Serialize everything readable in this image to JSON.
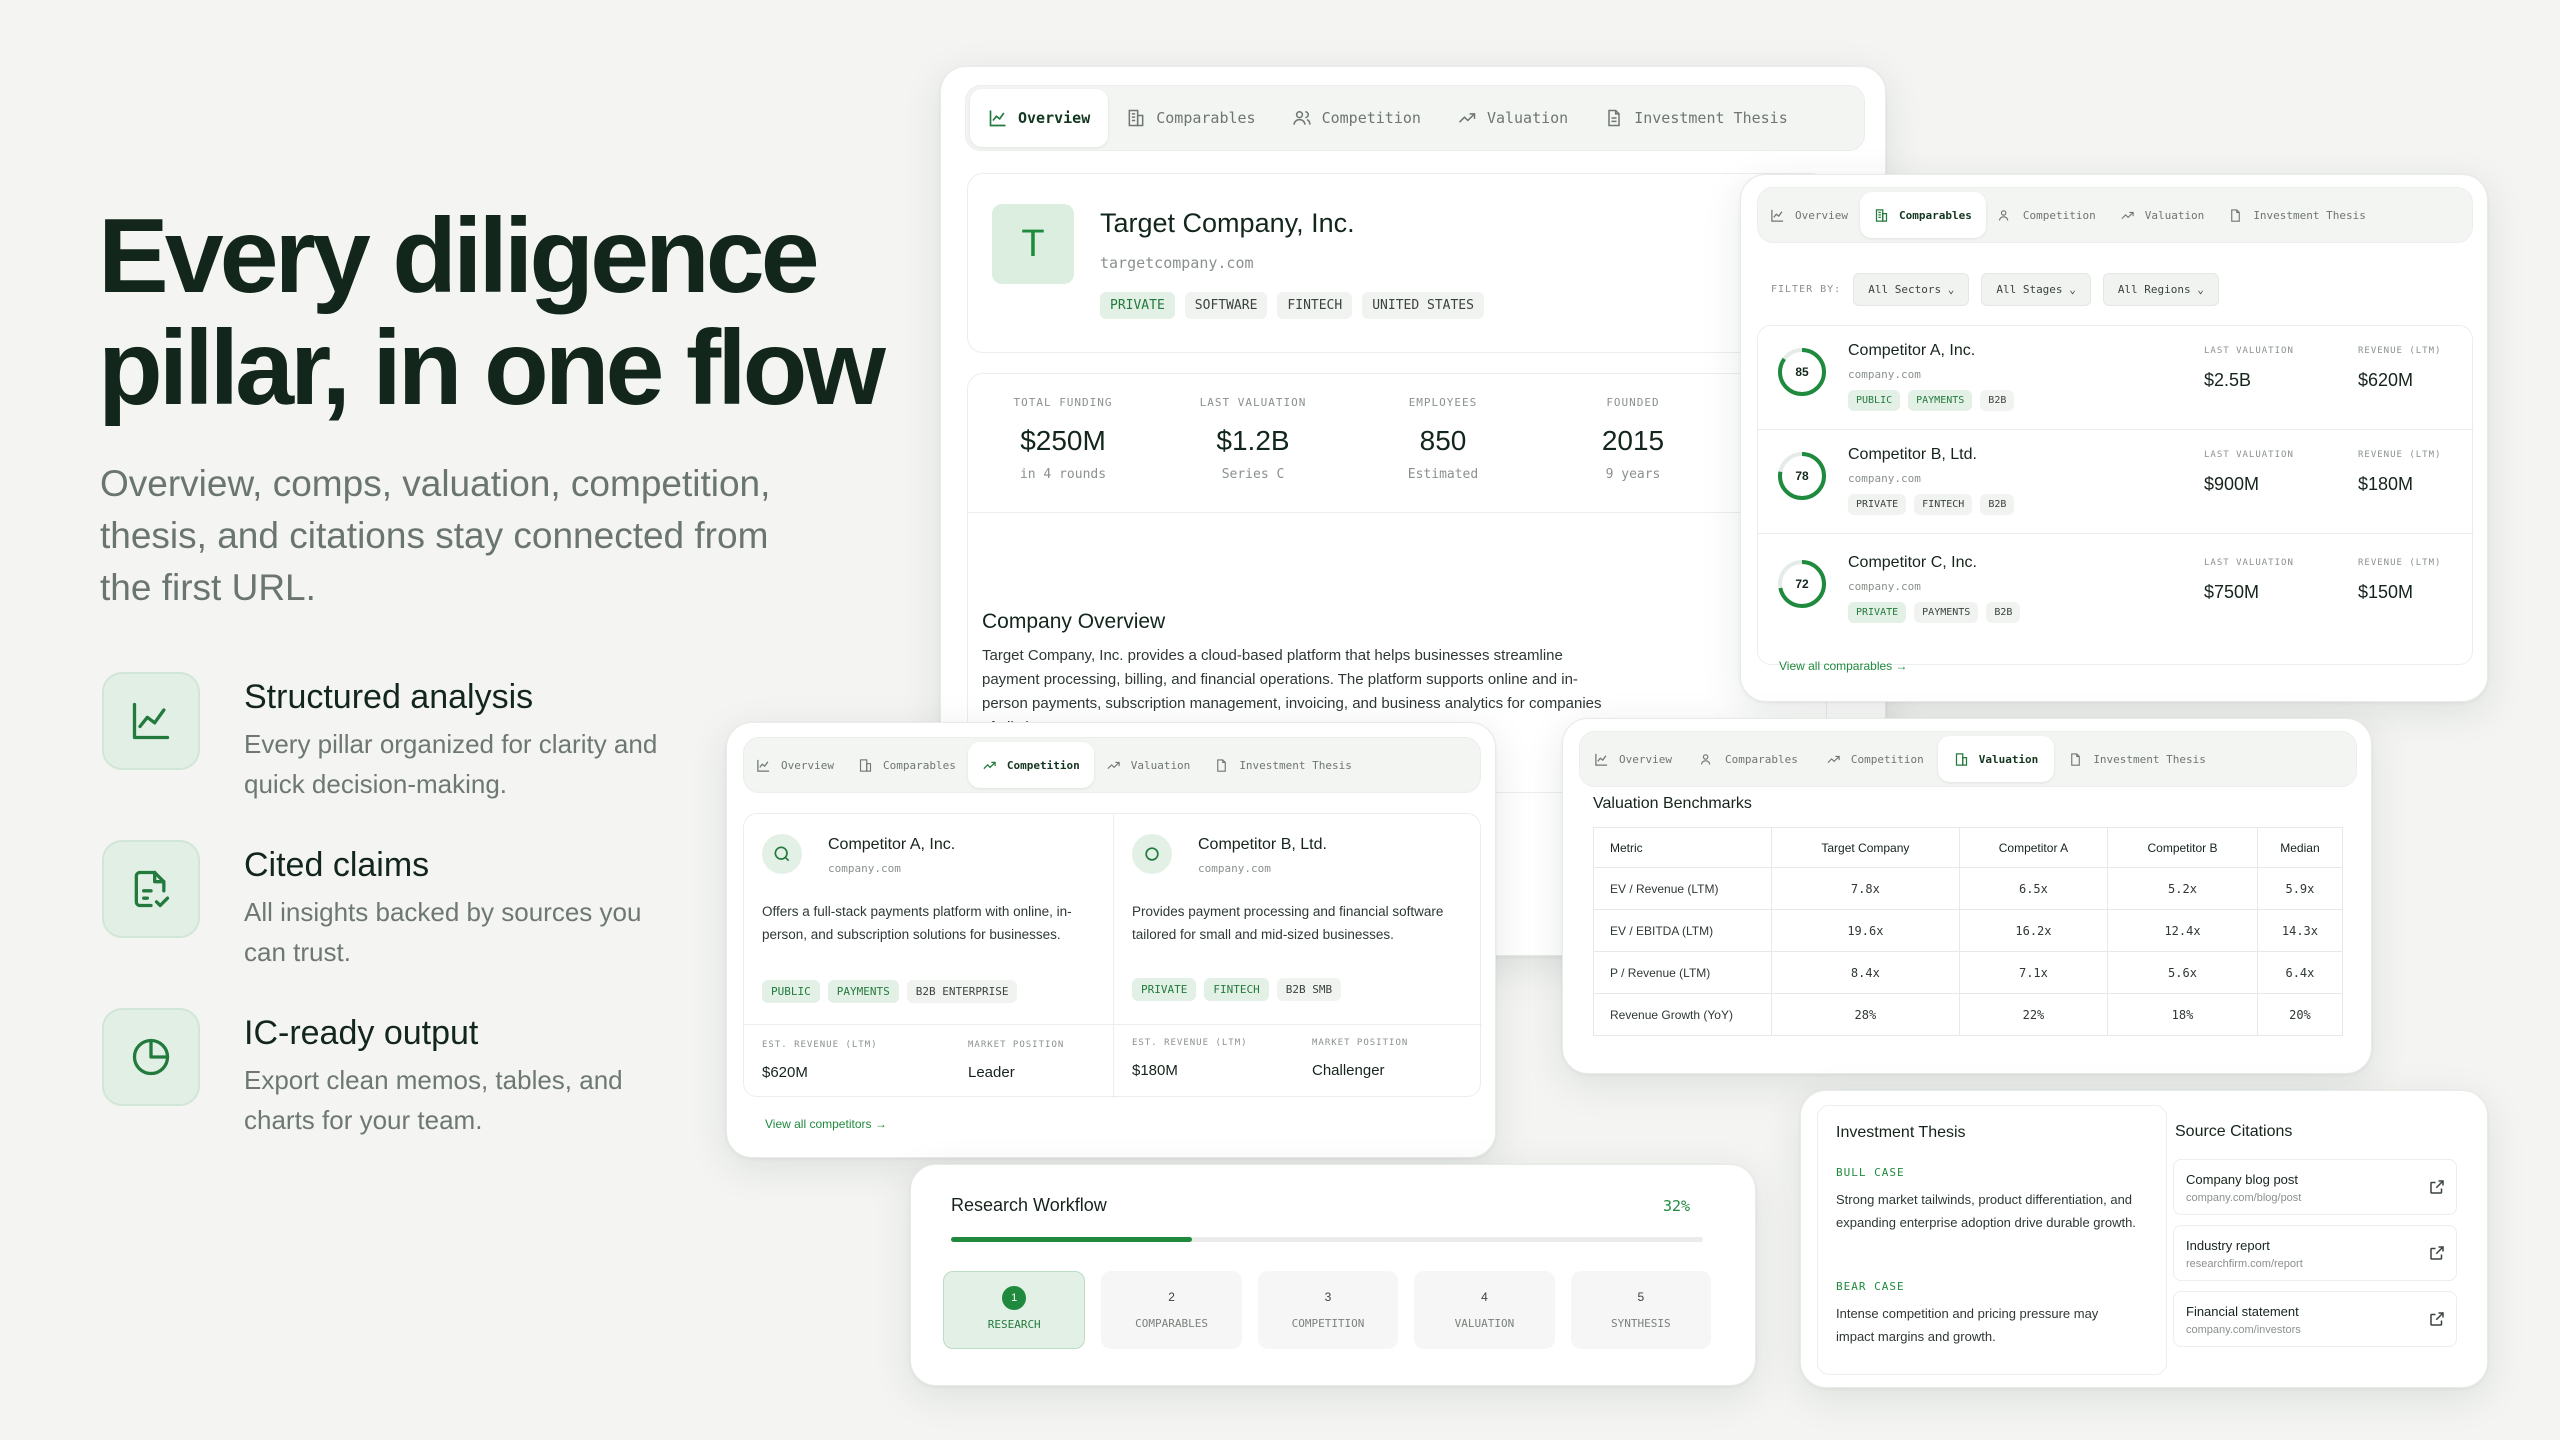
{
  "hero": {
    "title_line1": "Every diligence",
    "title_line2": "pillar, in one flow",
    "subtitle": "Overview, comps, valuation, competition, thesis, and citations stay connected from the first URL."
  },
  "features": [
    {
      "icon": "line-chart-icon",
      "title": "Structured analysis",
      "desc": "Every pillar organized for clarity and quick decision-making."
    },
    {
      "icon": "document-check-icon",
      "title": "Cited claims",
      "desc": "All insights backed by sources you can trust."
    },
    {
      "icon": "pie-chart-icon",
      "title": "IC-ready output",
      "desc": "Export clean memos, tables, and charts for your team."
    }
  ],
  "tabs": [
    "Overview",
    "Comparables",
    "Competition",
    "Valuation",
    "Investment Thesis"
  ],
  "overview": {
    "company_initial": "T",
    "company_name": "Target Company, Inc.",
    "domain": "targetcompany.com",
    "tags": [
      "PRIVATE",
      "SOFTWARE",
      "FINTECH",
      "UNITED STATES"
    ],
    "stats": [
      {
        "label": "TOTAL FUNDING",
        "value": "$250M",
        "sub": "in 4 rounds"
      },
      {
        "label": "LAST VALUATION",
        "value": "$1.2B",
        "sub": "Series C"
      },
      {
        "label": "EMPLOYEES",
        "value": "850",
        "sub": "Estimated"
      },
      {
        "label": "FOUNDED",
        "value": "2015",
        "sub": "9 years"
      }
    ],
    "section_title": "Company Overview",
    "description": "Target Company, Inc. provides a cloud-based platform that helps businesses streamline payment processing, billing, and financial operations. The platform supports online and in-person payments, subscription management, invoicing, and business analytics for companies of all sizes."
  },
  "comparables": {
    "filter_label": "FILTER BY:",
    "filters": [
      "All Sectors",
      "All Stages",
      "All Regions"
    ],
    "val_label": "LAST VALUATION",
    "rev_label": "REVENUE (LTM)",
    "rows": [
      {
        "score": "85",
        "score_pct": 85,
        "name": "Competitor A, Inc.",
        "domain": "company.com",
        "tags": [
          "PUBLIC",
          "PAYMENTS",
          "B2B"
        ],
        "valuation": "$2.5B",
        "revenue": "$620M"
      },
      {
        "score": "78",
        "score_pct": 78,
        "name": "Competitor B, Ltd.",
        "domain": "company.com",
        "tags": [
          "PRIVATE",
          "FINTECH",
          "B2B"
        ],
        "valuation": "$900M",
        "revenue": "$180M"
      },
      {
        "score": "72",
        "score_pct": 72,
        "name": "Competitor C, Inc.",
        "domain": "company.com",
        "tags": [
          "PRIVATE",
          "PAYMENTS",
          "B2B"
        ],
        "valuation": "$750M",
        "revenue": "$150M"
      }
    ],
    "view_all": "View all comparables →"
  },
  "competition": {
    "cards": [
      {
        "name": "Competitor A, Inc.",
        "domain": "company.com",
        "desc": "Offers a full-stack payments platform with online, in-person, and subscription solutions for businesses.",
        "tags": [
          "PUBLIC",
          "PAYMENTS",
          "B2B ENTERPRISE"
        ],
        "rev_label": "EST. REVENUE (LTM)",
        "rev": "$620M",
        "pos_label": "MARKET POSITION",
        "pos": "Leader"
      },
      {
        "name": "Competitor B, Ltd.",
        "domain": "company.com",
        "desc": "Provides payment processing and financial software tailored for small and mid-sized businesses.",
        "tags": [
          "PRIVATE",
          "FINTECH",
          "B2B SMB"
        ],
        "rev_label": "EST. REVENUE (LTM)",
        "rev": "$180M",
        "pos_label": "MARKET POSITION",
        "pos": "Challenger"
      }
    ],
    "view_all": "View all competitors →"
  },
  "valuation": {
    "title": "Valuation Benchmarks",
    "headers": [
      "Metric",
      "Target Company",
      "Competitor A",
      "Competitor B",
      "Median"
    ],
    "rows": [
      [
        "EV / Revenue (LTM)",
        "7.8x",
        "6.5x",
        "5.2x",
        "5.9x"
      ],
      [
        "EV / EBITDA (LTM)",
        "19.6x",
        "16.2x",
        "12.4x",
        "14.3x"
      ],
      [
        "P / Revenue (LTM)",
        "8.4x",
        "7.1x",
        "5.6x",
        "6.4x"
      ],
      [
        "Revenue Growth (YoY)",
        "28%",
        "22%",
        "18%",
        "20%"
      ]
    ]
  },
  "workflow": {
    "title": "Research Workflow",
    "percent": "32%",
    "progress": 0.32,
    "steps": [
      {
        "num": "1",
        "label": "RESEARCH"
      },
      {
        "num": "2",
        "label": "COMPARABLES"
      },
      {
        "num": "3",
        "label": "COMPETITION"
      },
      {
        "num": "4",
        "label": "VALUATION"
      },
      {
        "num": "5",
        "label": "SYNTHESIS"
      }
    ]
  },
  "thesis": {
    "title": "Investment Thesis",
    "bull_label": "BULL CASE",
    "bull_text": "Strong market tailwinds, product differentiation, and expanding enterprise adoption drive durable growth.",
    "bear_label": "BEAR CASE",
    "bear_text": "Intense competition and pricing pressure may impact margins and growth."
  },
  "citations": {
    "title": "Source Citations",
    "items": [
      {
        "title": "Company blog post",
        "url": "company.com/blog/post"
      },
      {
        "title": "Industry report",
        "url": "researchfirm.com/report"
      },
      {
        "title": "Financial statement",
        "url": "company.com/investors"
      }
    ]
  },
  "colors": {
    "accent": "#1f8a3e",
    "accent_bg": "#e3f0e6",
    "text": "#12261c"
  }
}
